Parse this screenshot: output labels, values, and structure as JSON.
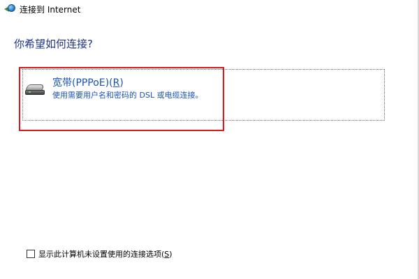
{
  "window": {
    "title": "连接到 Internet",
    "icon": "globe-arrow-icon"
  },
  "main": {
    "heading": "你希望如何连接?",
    "option": {
      "icon": "broadband-modem-icon",
      "title_prefix": "宽带(PPPoE)(",
      "title_mnemonic": "R",
      "title_suffix": ")",
      "description": "使用需要用户名和密码的 DSL 或电缆连接。",
      "highlighted": true
    }
  },
  "footer": {
    "checkbox_checked": false,
    "checkbox_label_prefix": "显示此计算机未设置使用的连接选项(",
    "checkbox_label_mnemonic": "S",
    "checkbox_label_suffix": ")"
  },
  "colors": {
    "heading": "#1e3287",
    "link": "#1a52b6",
    "highlight": "#e0161b"
  }
}
